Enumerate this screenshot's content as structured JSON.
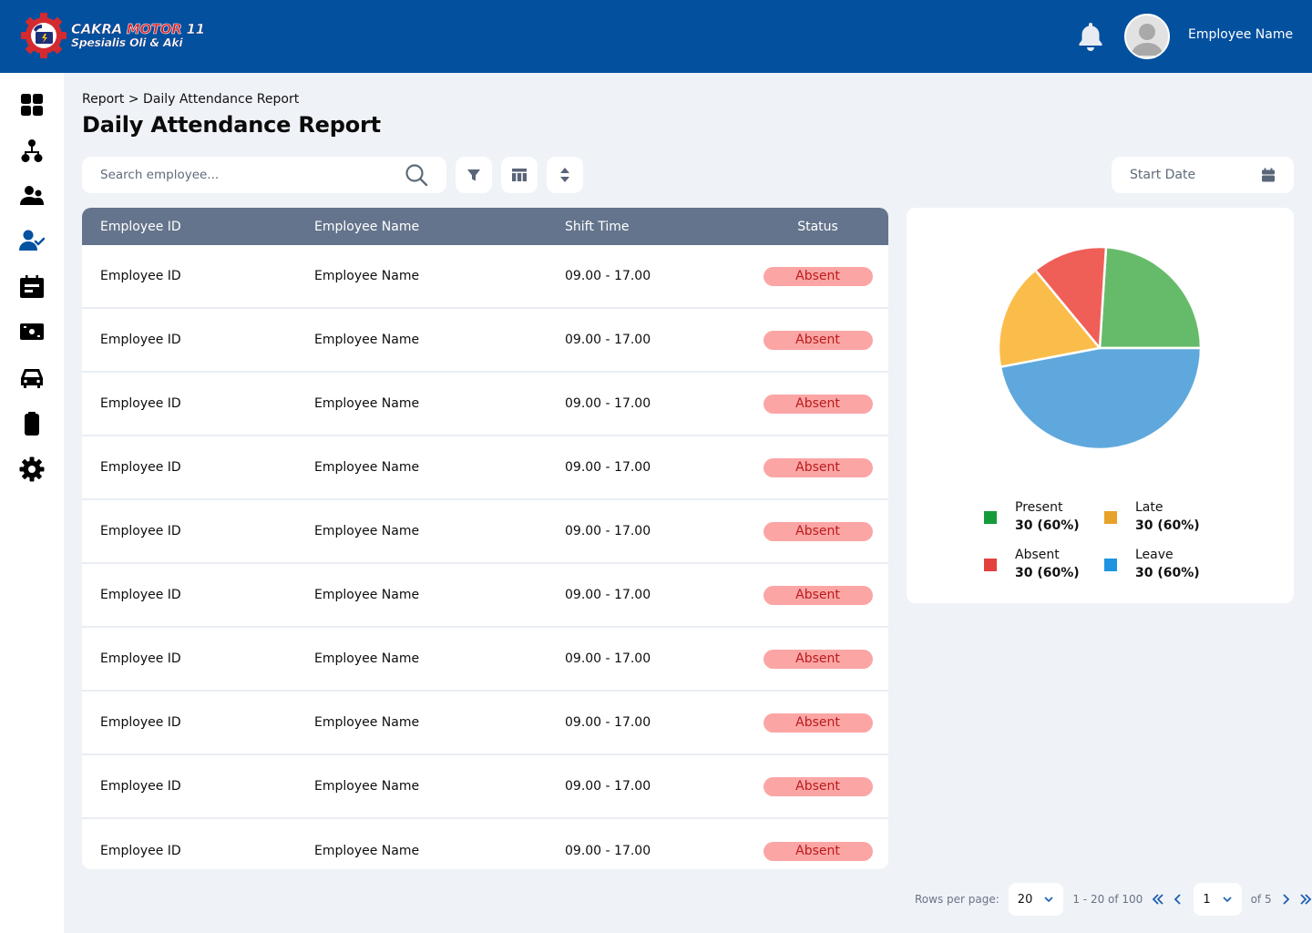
{
  "header": {
    "logo": {
      "line1_a": "CAKRA ",
      "line1_b": "MOTOR",
      "line1_c": " 11",
      "line2": "Spesialis Oli & Aki"
    },
    "user_name": "Employee Name",
    "icons": {
      "notification": "bell-icon",
      "avatar": "user-avatar-icon"
    }
  },
  "sidebar": {
    "active_color": "#0452a0",
    "items": [
      {
        "id": "dashboard",
        "icon": "grid-icon",
        "active": false
      },
      {
        "id": "organization",
        "icon": "org-chart-icon",
        "active": false
      },
      {
        "id": "employees",
        "icon": "users-icon",
        "active": false
      },
      {
        "id": "attendance",
        "icon": "user-check-icon",
        "active": true
      },
      {
        "id": "schedule",
        "icon": "calendar-list-icon",
        "active": false
      },
      {
        "id": "payroll",
        "icon": "money-icon",
        "active": false
      },
      {
        "id": "vehicles",
        "icon": "car-icon",
        "active": false
      },
      {
        "id": "clipboard",
        "icon": "clipboard-icon",
        "active": false
      },
      {
        "id": "settings",
        "icon": "gear-icon",
        "active": false
      }
    ]
  },
  "breadcrumb": "Report > Daily Attendance Report",
  "page_title": "Daily Attendance Report",
  "toolbar": {
    "search_placeholder": "Search employee...",
    "filter_icon": "filter-icon",
    "columns_icon": "columns-icon",
    "sort_icon": "sort-icon",
    "start_date_placeholder": "Start Date"
  },
  "table": {
    "columns": [
      "Employee ID",
      "Employee Name",
      "Shift Time",
      "Status"
    ],
    "rows": [
      {
        "id": "Employee ID",
        "name": "Employee Name",
        "shift": "09.00 - 17.00",
        "status": "Absent"
      },
      {
        "id": "Employee ID",
        "name": "Employee Name",
        "shift": "09.00 - 17.00",
        "status": "Absent"
      },
      {
        "id": "Employee ID",
        "name": "Employee Name",
        "shift": "09.00 - 17.00",
        "status": "Absent"
      },
      {
        "id": "Employee ID",
        "name": "Employee Name",
        "shift": "09.00 - 17.00",
        "status": "Absent"
      },
      {
        "id": "Employee ID",
        "name": "Employee Name",
        "shift": "09.00 - 17.00",
        "status": "Absent"
      },
      {
        "id": "Employee ID",
        "name": "Employee Name",
        "shift": "09.00 - 17.00",
        "status": "Absent"
      },
      {
        "id": "Employee ID",
        "name": "Employee Name",
        "shift": "09.00 - 17.00",
        "status": "Absent"
      },
      {
        "id": "Employee ID",
        "name": "Employee Name",
        "shift": "09.00 - 17.00",
        "status": "Absent"
      },
      {
        "id": "Employee ID",
        "name": "Employee Name",
        "shift": "09.00 - 17.00",
        "status": "Absent"
      },
      {
        "id": "Employee ID",
        "name": "Employee Name",
        "shift": "09.00 - 17.00",
        "status": "Absent"
      }
    ]
  },
  "chart_data": {
    "type": "pie",
    "title": "",
    "slices": [
      {
        "name": "Present",
        "value": 24,
        "color": "#66bb6a"
      },
      {
        "name": "Absent",
        "value": 12,
        "color": "#ef5f57"
      },
      {
        "name": "Late",
        "value": 17,
        "color": "#fbbd4a"
      },
      {
        "name": "Leave",
        "value": 47,
        "color": "#5fa8dd"
      }
    ],
    "start_angle_deg": 0,
    "direction": "counterclockwise",
    "legend_position": "bottom",
    "legend": [
      {
        "label": "Present",
        "value": "30 (60%)",
        "color": "#149c3a"
      },
      {
        "label": "Late",
        "value": "30 (60%)",
        "color": "#e8a22a"
      },
      {
        "label": "Absent",
        "value": "30 (60%)",
        "color": "#e2413c"
      },
      {
        "label": "Leave",
        "value": "30 (60%)",
        "color": "#1f95e0"
      }
    ]
  },
  "pagination": {
    "rows_per_page_label": "Rows per page:",
    "rows_per_page": "20",
    "range": "1 - 20 of 100",
    "current_page": "1",
    "total_pages_label": "of 5",
    "accent_color": "#1b5fb0"
  }
}
